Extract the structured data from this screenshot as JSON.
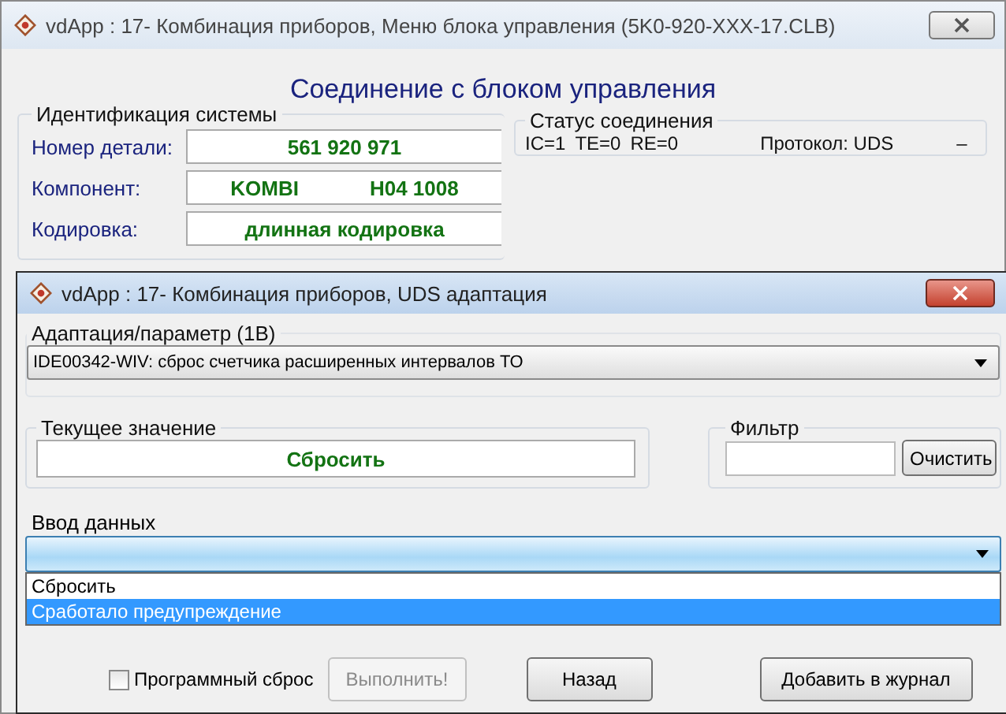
{
  "main_window": {
    "title": "vdApp : 17- Комбинация приборов,  Меню блока управления (5K0-920-XXX-17.CLB)",
    "heading": "Соединение с блоком управления",
    "identification": {
      "title": "Идентификация системы",
      "rows": [
        {
          "label": "Номер детали:",
          "values": [
            "561 920 971"
          ]
        },
        {
          "label": "Компонент:",
          "values": [
            "KOMBI",
            "H04 1008"
          ]
        },
        {
          "label": "Кодировка:",
          "values": [
            "длинная кодировка"
          ]
        }
      ]
    },
    "connection_status": {
      "title": "Статус соединения",
      "items": [
        "IC=1",
        "TE=0",
        "RE=0",
        "Протокол: UDS",
        "–"
      ]
    }
  },
  "dialog": {
    "title": "vdApp : 17- Комбинация приборов,  UDS адаптация",
    "parameter": {
      "label": "Адаптация/параметр (1В)",
      "value": "IDE00342-WIV: сброс счетчика расширенных интервалов ТО"
    },
    "current_value": {
      "label": "Текущее значение",
      "value": "Сбросить"
    },
    "filter": {
      "label": "Фильтр",
      "button": "Очистить"
    },
    "data_input": {
      "label": "Ввод данных",
      "options": [
        {
          "label": "Сбросить",
          "selected": false
        },
        {
          "label": "Сработало предупреждение",
          "selected": true
        }
      ]
    },
    "software_reset": {
      "label": "Программный сброс",
      "checked": false
    },
    "buttons": [
      {
        "label": "Выполнить!",
        "disabled": true
      },
      {
        "label": "Назад",
        "disabled": false
      },
      {
        "label": "Добавить в журнал",
        "disabled": false
      }
    ]
  }
}
